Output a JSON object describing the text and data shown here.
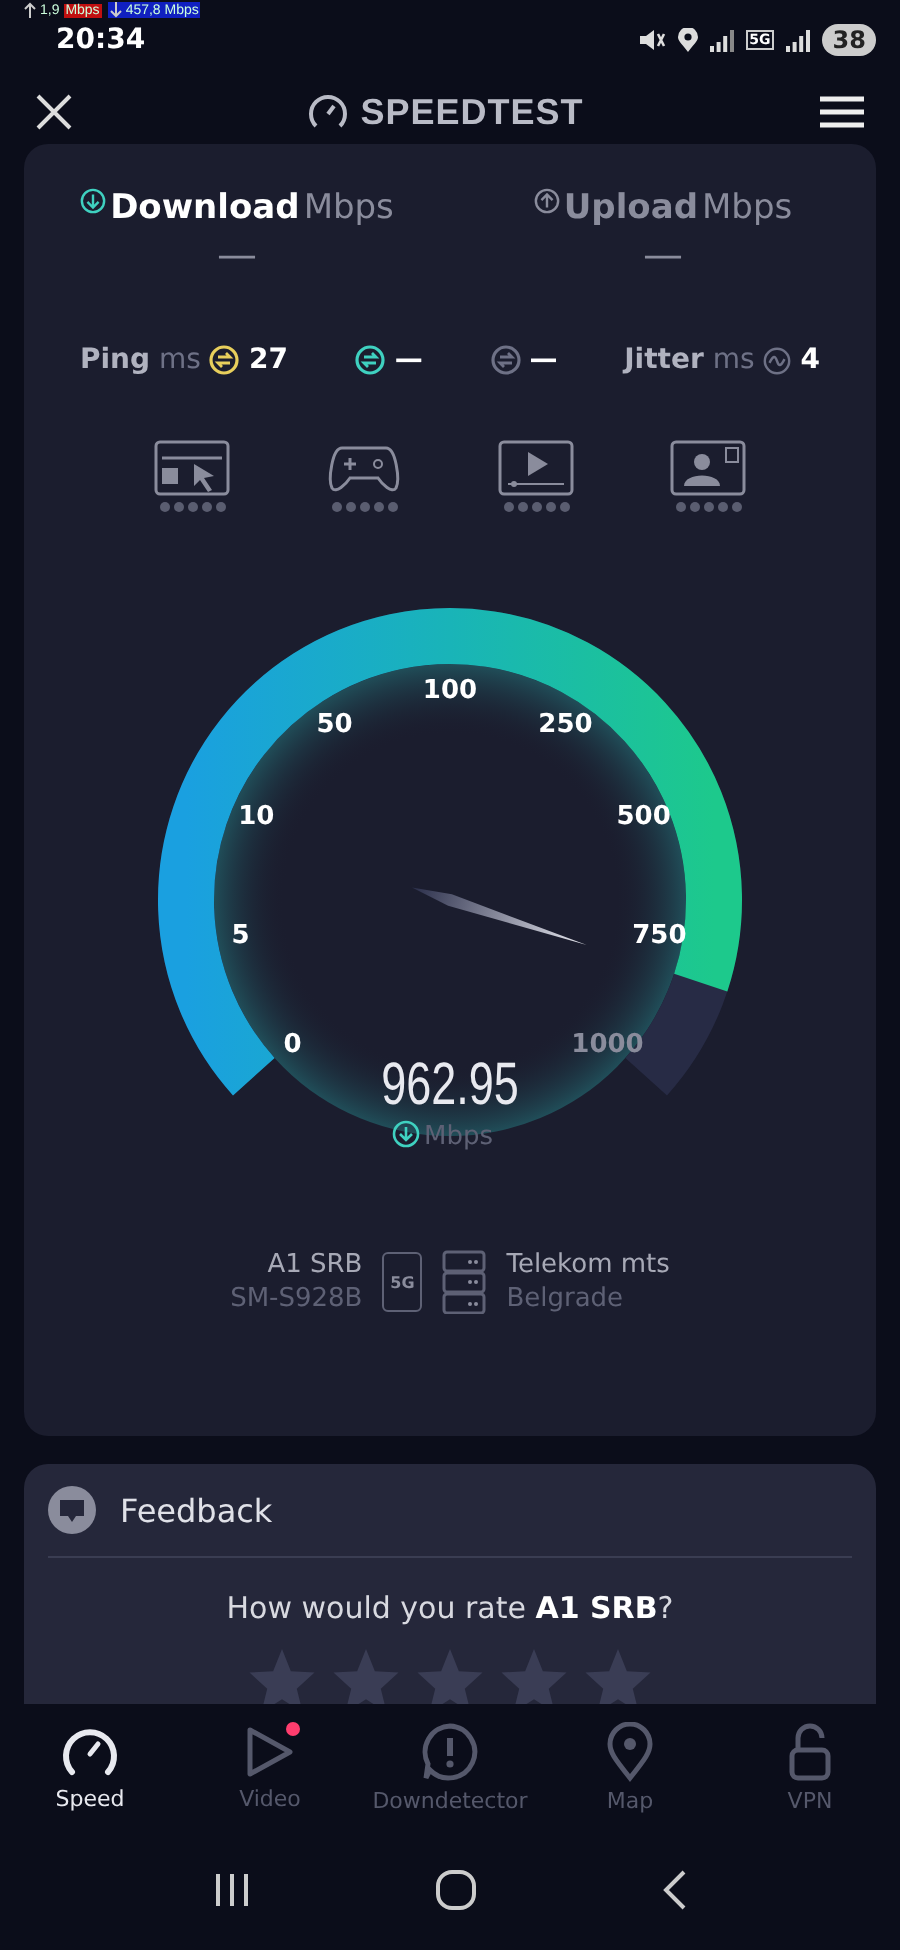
{
  "status_bar": {
    "upload": {
      "value": "1,9",
      "unit": "Mbps"
    },
    "download": {
      "value": "457,8",
      "unit": "Mbps"
    },
    "time": "20:34",
    "network": "5G",
    "battery": "38"
  },
  "header": {
    "title": "SPEEDTEST"
  },
  "tabs": [
    {
      "label": "Download",
      "unit": "Mbps",
      "value": "—",
      "kind": "download",
      "selected": true
    },
    {
      "label": "Upload",
      "unit": "Mbps",
      "value": "—",
      "kind": "upload",
      "selected": false
    }
  ],
  "metrics": [
    {
      "kind": "ping",
      "label": "Ping",
      "unit": "ms",
      "value": "27",
      "color": "#e8cf5c"
    },
    {
      "kind": "ping",
      "value": "—",
      "color": "#3fd1c0"
    },
    {
      "kind": "ping",
      "value": "—",
      "color": "#6e7186"
    },
    {
      "kind": "jitter",
      "label": "Jitter",
      "unit": "ms",
      "value": "4",
      "color": "#6e7186"
    }
  ],
  "activities": [
    {
      "kind": "browsing",
      "stars": 0
    },
    {
      "kind": "gaming",
      "stars": 0
    },
    {
      "kind": "video",
      "stars": 0
    },
    {
      "kind": "call",
      "stars": 0
    }
  ],
  "gauge": {
    "ticks": [
      "0",
      "5",
      "10",
      "50",
      "100",
      "250",
      "500",
      "750",
      "1000"
    ],
    "value": "962.95",
    "unit": "Mbps"
  },
  "connection": {
    "provider": "A1 SRB",
    "device": "SM-S928B",
    "network": "5G",
    "server": "Telekom mts",
    "city": "Belgrade"
  },
  "feedback": {
    "title": "Feedback",
    "question": "How would you rate **A1 SRB**?"
  },
  "nav": [
    {
      "kind": "speed",
      "label": "Speed",
      "selected": true,
      "badge": false
    },
    {
      "kind": "video",
      "label": "Video",
      "selected": false,
      "badge": true
    },
    {
      "kind": "alert",
      "label": "Downdetector",
      "selected": false,
      "badge": false
    },
    {
      "kind": "map",
      "label": "Map",
      "selected": false,
      "badge": false
    },
    {
      "kind": "vpn",
      "label": "VPN",
      "selected": false,
      "badge": false
    }
  ]
}
